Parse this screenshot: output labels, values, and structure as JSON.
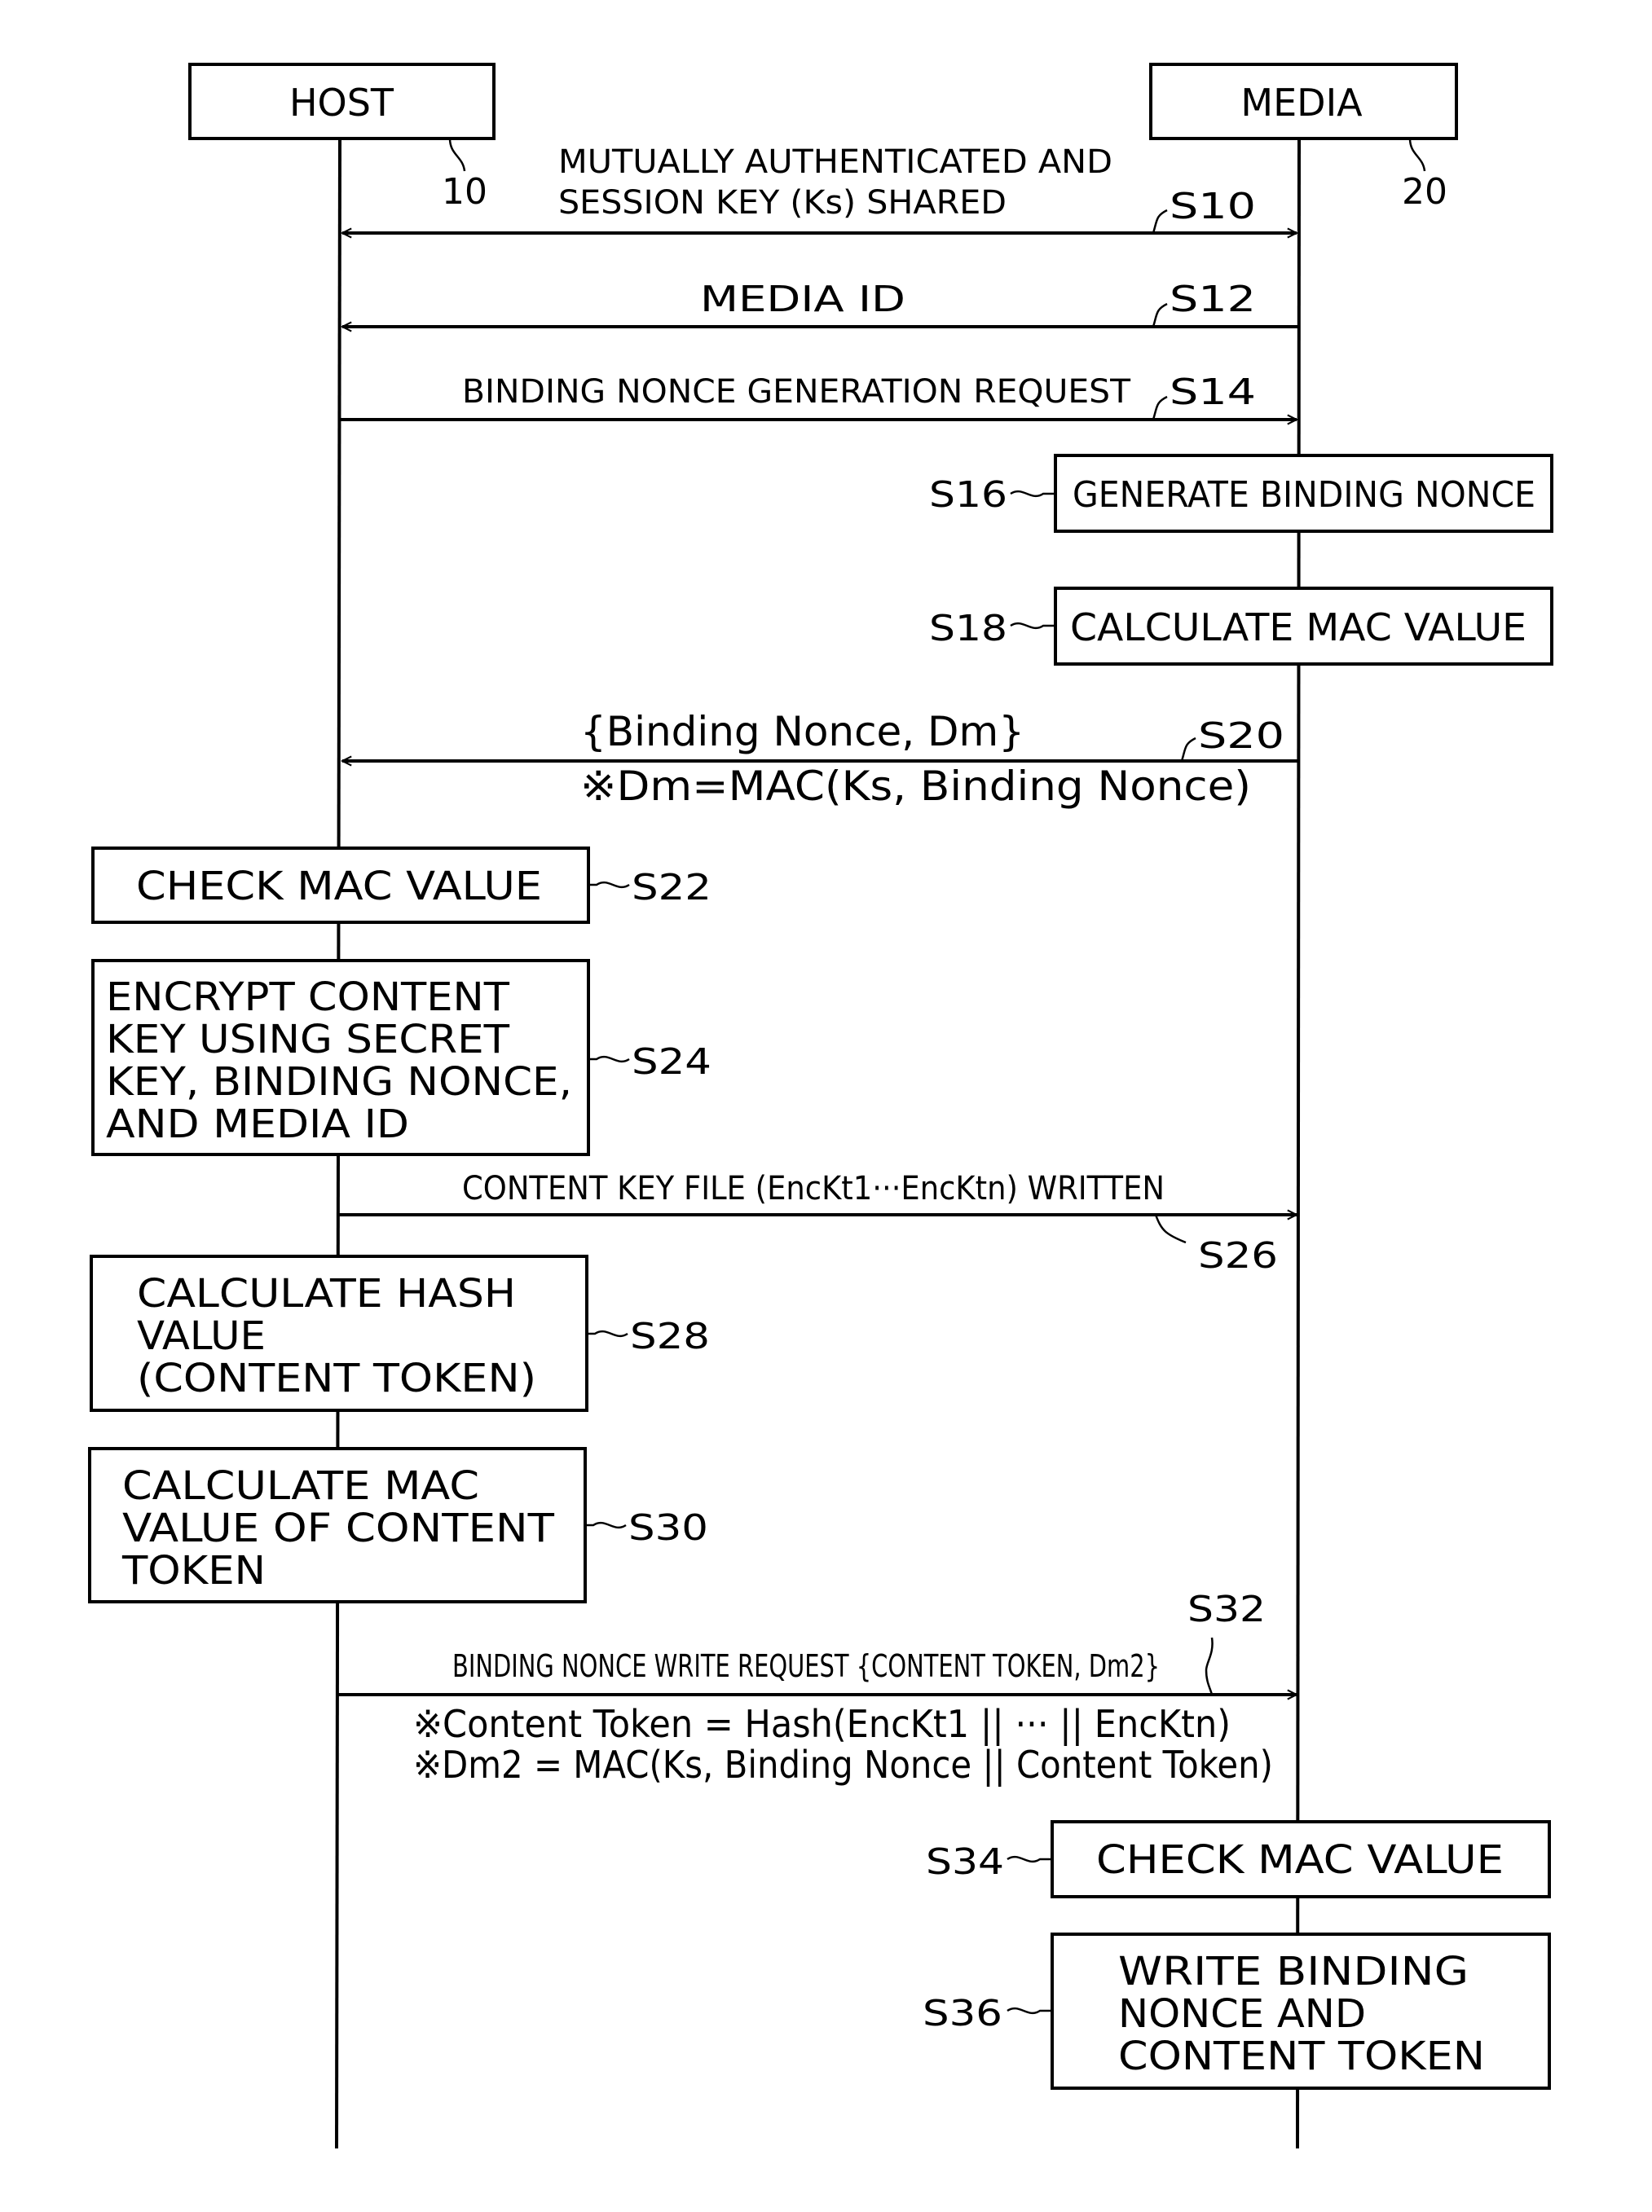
{
  "figure": {
    "actors": [
      {
        "id": "host",
        "label": "HOST",
        "ref": "10"
      },
      {
        "id": "media",
        "label": "MEDIA",
        "ref": "20"
      }
    ],
    "messages": [
      {
        "step": "S10",
        "direction": "both",
        "lines": [
          "MUTUALLY AUTHENTICATED AND",
          "SESSION KEY (Ks) SHARED"
        ],
        "notes": []
      },
      {
        "step": "S12",
        "direction": "to-host",
        "lines": [
          "MEDIA ID"
        ],
        "notes": []
      },
      {
        "step": "S14",
        "direction": "to-media",
        "lines": [
          "BINDING NONCE GENERATION REQUEST"
        ],
        "notes": []
      },
      {
        "step": "S20",
        "direction": "to-host",
        "lines": [
          "{Binding Nonce, Dm}"
        ],
        "notes": [
          "※Dm=MAC(Ks, Binding Nonce)"
        ]
      },
      {
        "step": "S26",
        "direction": "to-media",
        "lines": [
          "CONTENT KEY FILE (EncKt1···EncKtn) WRITTEN"
        ],
        "notes": []
      },
      {
        "step": "S32",
        "direction": "to-media",
        "lines": [
          "BINDING NONCE WRITE REQUEST {CONTENT TOKEN, Dm2}"
        ],
        "notes": [
          "※Content Token = Hash(EncKt1 || ··· || EncKtn)",
          "※Dm2 = MAC(Ks, Binding Nonce || Content Token)"
        ]
      }
    ],
    "processes": [
      {
        "step": "S16",
        "actor": "media",
        "lines": [
          "GENERATE BINDING NONCE"
        ]
      },
      {
        "step": "S18",
        "actor": "media",
        "lines": [
          "CALCULATE MAC VALUE"
        ]
      },
      {
        "step": "S22",
        "actor": "host",
        "lines": [
          "CHECK MAC VALUE"
        ]
      },
      {
        "step": "S24",
        "actor": "host",
        "lines": [
          "ENCRYPT CONTENT",
          "KEY USING SECRET",
          "KEY, BINDING NONCE,",
          "AND MEDIA ID"
        ]
      },
      {
        "step": "S28",
        "actor": "host",
        "lines": [
          "CALCULATE HASH",
          "VALUE",
          "(CONTENT TOKEN)"
        ]
      },
      {
        "step": "S30",
        "actor": "host",
        "lines": [
          "CALCULATE MAC",
          "VALUE OF CONTENT",
          "TOKEN"
        ]
      },
      {
        "step": "S34",
        "actor": "media",
        "lines": [
          "CHECK MAC VALUE"
        ]
      },
      {
        "step": "S36",
        "actor": "media",
        "lines": [
          "WRITE BINDING",
          "NONCE AND",
          "CONTENT TOKEN"
        ]
      }
    ]
  }
}
